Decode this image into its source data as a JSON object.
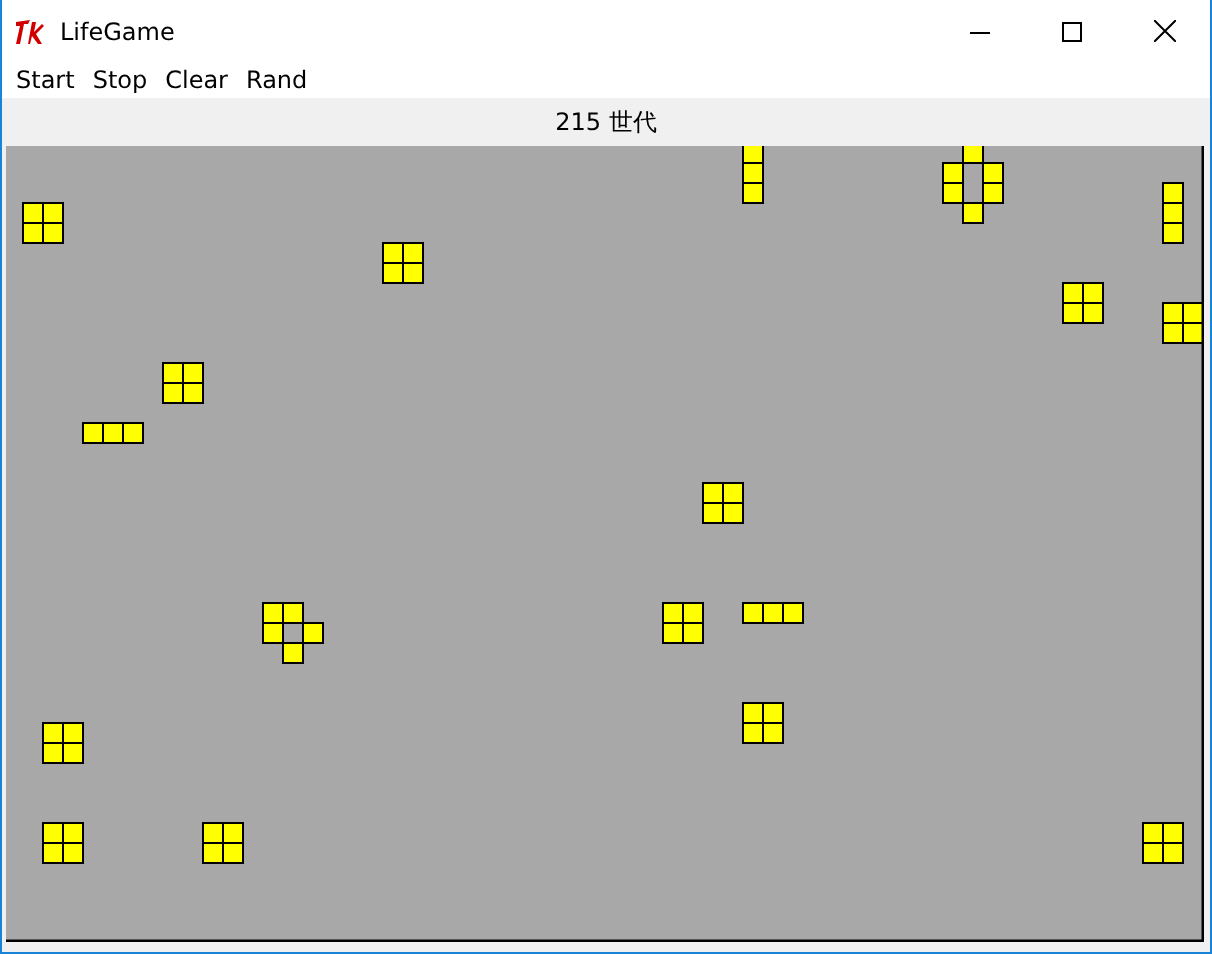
{
  "window": {
    "title": "LifeGame"
  },
  "menu": [
    "Start",
    "Stop",
    "Clear",
    "Rand"
  ],
  "generation_label": "215 世代"
}
